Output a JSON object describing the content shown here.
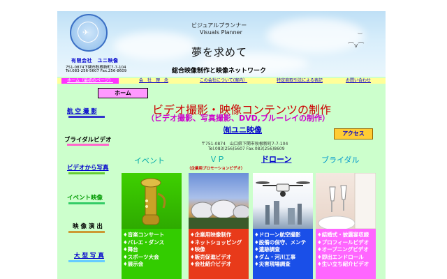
{
  "header": {
    "title_jp": "ビジュアルプランナー",
    "title_en": "Visuals Planner",
    "slogan": "夢を求めて",
    "subtitle": "総合映像制作と映像ネットワーク",
    "company_name": "有限会社　ユニ映像",
    "address": "751-0874下関市秋根新町7-7-104",
    "phone": "Tel.083-256-5607 Fax.256-8609"
  },
  "nav": {
    "items": [
      {
        "label": "ホーム（最初のページ）"
      },
      {
        "label": "会　社　理　念"
      },
      {
        "label": "この会社について(案内）"
      },
      {
        "label": "特定商取引法による表記"
      },
      {
        "label": "お問い合わせ"
      }
    ]
  },
  "sidebar": {
    "home_label": "ホーム",
    "items": [
      {
        "label": "航 空 撮 影"
      },
      {
        "label": "ブライダルビデオ"
      },
      {
        "label": "ビデオから写真"
      },
      {
        "label": "イベント映像"
      },
      {
        "label": "映 像 演 出"
      },
      {
        "label": "大 型 写 真"
      }
    ]
  },
  "main": {
    "title": "ビデオ撮影・映像コンテンツの制作",
    "subtitle": "（ビデオ撮影、写真撮影、DVD,ブルーレイの制作）",
    "company_link": "㈲ユニ映像",
    "postal": "〒751-0874　山口県下関市秋根新町7-7-104",
    "tel": "Tel.083(256)5607 Fax.083(256)8609",
    "access_label": "アクセス"
  },
  "columns": [
    {
      "heading": "イベント",
      "subheading": "",
      "items": [
        "♦音楽コンサート",
        "♦バレエ・ダンス",
        "♦舞台",
        "♦スポーツ大会",
        "♦展示会"
      ]
    },
    {
      "heading": "ＶＰ",
      "subheading": "（企業用プロモーションビデオ）",
      "items": [
        "♦企業用映像制作",
        "♦ネットショッピング",
        "♦映像",
        "♦販売促進ビデオ",
        "♦会社紹介ビデオ"
      ]
    },
    {
      "heading": "ドローン",
      "subheading": "",
      "items": [
        "♦ドローン航空撮影",
        "♦設備の保守、メンテ",
        "♦遺跡調査",
        "♦ダム・河川工事",
        "♦災害現場調査"
      ]
    },
    {
      "heading": "ブライダル",
      "subheading": "",
      "items": [
        "♦結婚式・披露宴収録",
        "♦プロフィールビデオ",
        "♦オープニングビデオ",
        "♦即出エンドロール",
        "♦生い立ち紹介ビデオ"
      ]
    }
  ],
  "colors": {
    "page_bg": "#ccffcc",
    "nav_bg": "#ffff99",
    "nav_active": "#ff33ff",
    "title_red": "#cc0000",
    "subtitle_magenta": "#cc00cc",
    "link_blue": "#0000cc",
    "panel_green": "#33cc00",
    "panel_red": "#e83a1a",
    "panel_blue": "#1a4fe8",
    "panel_pink": "#ff66ff"
  }
}
